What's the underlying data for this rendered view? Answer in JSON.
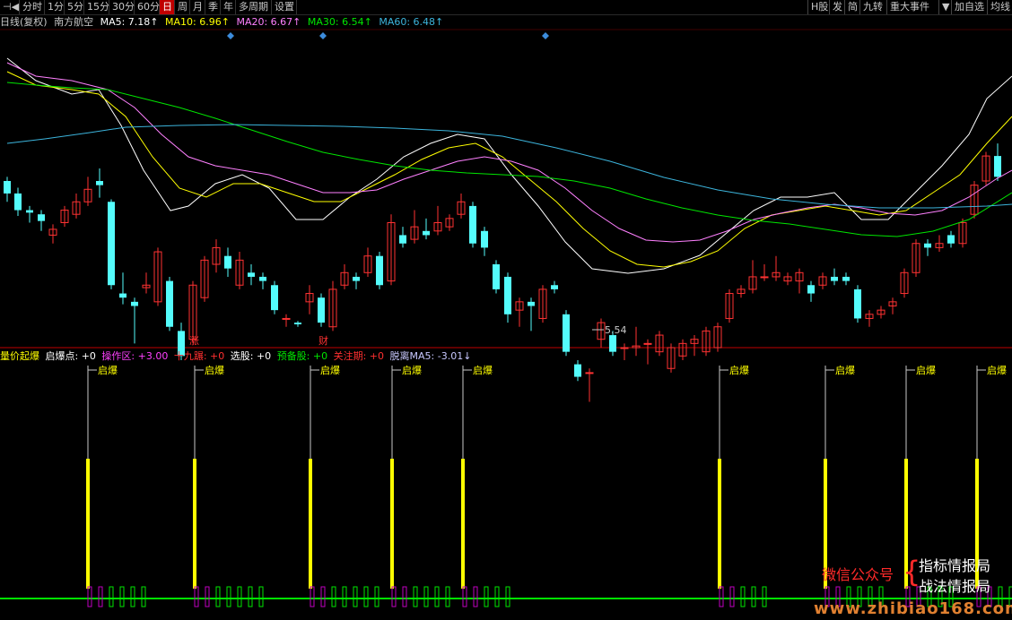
{
  "toolbar": {
    "left_items": [
      "⊣◀",
      "分时",
      "1分",
      "5分",
      "15分",
      "30分",
      "60分",
      "日",
      "周",
      "月",
      "季",
      "年",
      "多周期",
      "设置"
    ],
    "active_index": 7,
    "right_items": [
      "H股",
      "发",
      "简",
      "九转",
      "重大事件",
      "▼",
      "加自选",
      "均线"
    ]
  },
  "info": {
    "period": "日线(复权)",
    "stock": "南方航空",
    "ma5": "MA5: 7.18↑",
    "ma10": "MA10: 6.96↑",
    "ma20": "MA20: 6.67↑",
    "ma30": "MA30: 6.54↑",
    "ma60": "MA60: 6.48↑"
  },
  "indicator": {
    "name": "量价起爆",
    "qibao": "启爆点: +0",
    "caozuo": "操作区: +3.00",
    "shijiu": "十九蹍: +0",
    "xuangu": "选股: +0",
    "yubei": "预备股: +0",
    "guanzhu": "关注期: +0",
    "tuoli": "脱离MA5: -3.01↓"
  },
  "annotations": {
    "low_price": "5.54",
    "mark_zhang": "涨",
    "mark_cai": "财",
    "signal_label": "启爆"
  },
  "watermark": {
    "wechat": "微信公众号",
    "name1": "指标情报局",
    "name2": "战法情报局",
    "site": "www.zhibiao168.com"
  },
  "colors": {
    "up": "#ff3232",
    "down": "#54fcfc",
    "ma5": "#ffffff",
    "ma10": "#ffff00",
    "ma20": "#ff80ff",
    "ma30": "#00e600",
    "ma60": "#3cb4dc",
    "signal": "#ffff00",
    "lower_green": "#00e600",
    "lower_purple": "#c000c0"
  }
}
